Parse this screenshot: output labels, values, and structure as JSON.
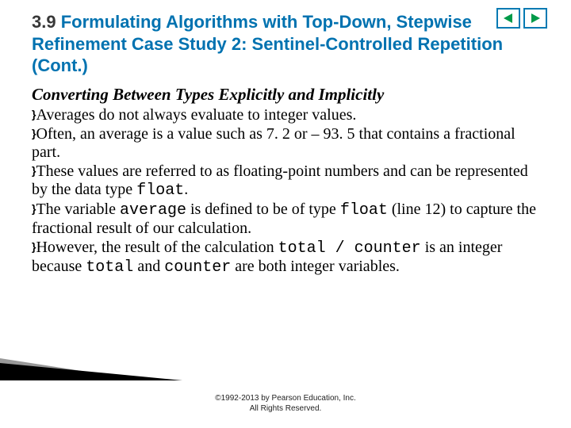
{
  "nav": {
    "prev": "prev",
    "next": "next"
  },
  "heading": {
    "number": "3.9",
    "title": "Formulating Algorithms with Top-Down, Stepwise Refinement Case Study 2: Sentinel-Controlled Repetition (Cont.)"
  },
  "subtitle": "Converting Between Types Explicitly and Implicitly",
  "bullets": {
    "b1": "Averages do not always evaluate to integer values.",
    "b2a": "Often, an average is a value such as 7. 2 or – 93. 5 that contains a fractional part.",
    "b3a": "These values are referred to as floating-point numbers and can be represented by the data type ",
    "b3code": "float",
    "b3b": ".",
    "b4a": "The variable ",
    "b4code1": "average",
    "b4b": " is defined to be of type ",
    "b4code2": "float",
    "b4c": " (line 12) to capture the fractional result of our calculation.",
    "b5a": "However, the result of the calculation ",
    "b5code1": "total / counter",
    "b5b": " is an integer because ",
    "b5code2": "total",
    "b5c": " and ",
    "b5code3": "counter",
    "b5d": " are both integer variables."
  },
  "copyright": {
    "line1": "©1992-2013 by Pearson Education, Inc.",
    "line2": "All Rights Reserved."
  }
}
